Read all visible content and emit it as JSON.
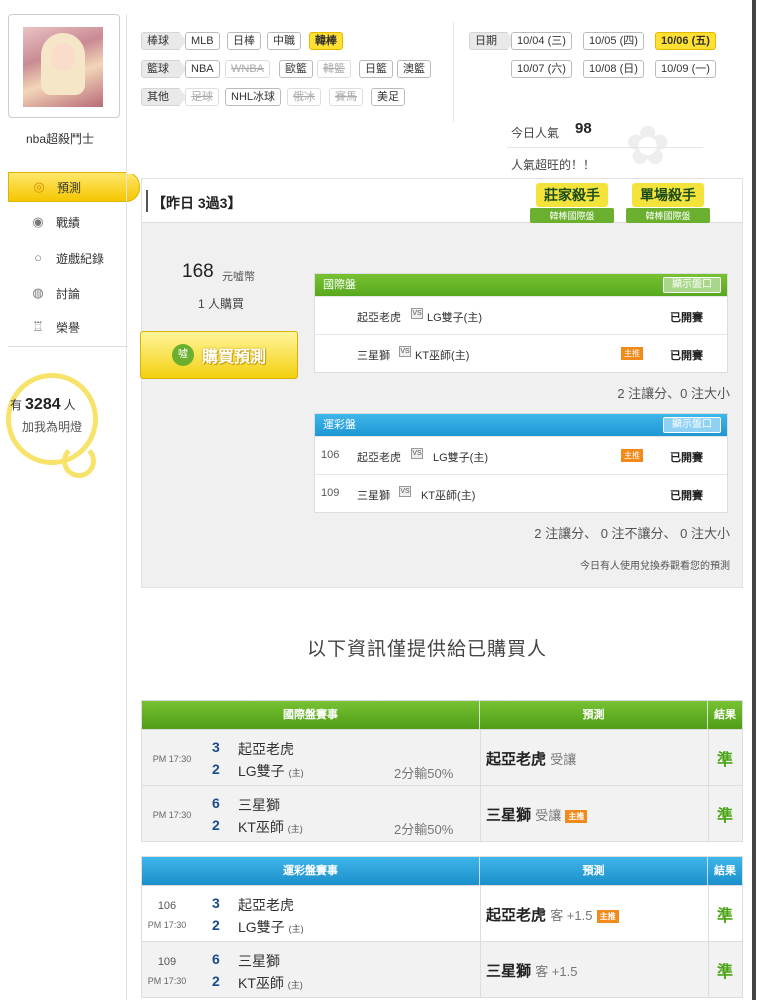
{
  "profile": {
    "username": "nba超殺鬥士"
  },
  "sidebar": {
    "items": [
      {
        "label": "預測",
        "icon": "target-icon",
        "active": true
      },
      {
        "label": "戰績",
        "icon": "record-icon",
        "active": false
      },
      {
        "label": "遊戲紀錄",
        "icon": "circle-icon",
        "active": false
      },
      {
        "label": "討論",
        "icon": "chat-icon",
        "active": false
      },
      {
        "label": "榮譽",
        "icon": "medal-icon",
        "active": false
      }
    ],
    "fans": {
      "prefix": "有",
      "count": "3284",
      "suffix": "人",
      "sub": "加我為明燈"
    }
  },
  "filters": {
    "baseball": {
      "label": "棒球",
      "items": [
        "MLB",
        "日棒",
        "中職",
        "韓棒"
      ]
    },
    "basketball": {
      "label": "籃球",
      "items": [
        "NBA",
        "WNBA",
        "歐籃",
        "韓籃",
        "日籃",
        "澳籃"
      ]
    },
    "other": {
      "label": "其他",
      "items": [
        "足球",
        "NHL冰球",
        "俄冰",
        "賽馬",
        "美足"
      ]
    },
    "date": {
      "label": "日期",
      "items": [
        "10/04 (三)",
        "10/05 (四)",
        "10/06 (五)",
        "10/07 (六)",
        "10/08 (日)",
        "10/09 (一)"
      ]
    }
  },
  "popularity": {
    "label": "今日人氣",
    "value": "98",
    "text": "人氣超旺的！！"
  },
  "panel": {
    "title": "【昨日 3過3】",
    "badges": [
      {
        "main": "莊家殺手",
        "sub": "韓棒國際盤"
      },
      {
        "main": "單場殺手",
        "sub": "韓棒國際盤"
      }
    ],
    "price": "168",
    "price_unit": "元噓幣",
    "buyers": "1 人購買",
    "buy_label": "購買預測",
    "buy_icon": "噓",
    "intl": {
      "title": "國際盤",
      "show": "顯示盤口",
      "rows": [
        {
          "num": "",
          "home": "起亞老虎",
          "away": "LG雙子(主)",
          "hot": "",
          "status": "已開賽"
        },
        {
          "num": "",
          "home": "三星獅",
          "away": "KT巫師(主)",
          "hot": "主推",
          "status": "已開賽"
        }
      ],
      "summary": "2 注讓分、0 注大小"
    },
    "lottery": {
      "title": "運彩盤",
      "show": "顯示盤口",
      "rows": [
        {
          "num": "106",
          "home": "起亞老虎",
          "away": "LG雙子(主)",
          "hot": "主推",
          "status": "已開賽"
        },
        {
          "num": "109",
          "home": "三星獅",
          "away": "KT巫師(主)",
          "hot": "",
          "status": "已開賽"
        }
      ],
      "summary": "2 注讓分、 0 注不讓分、 0 注大小"
    },
    "vs": "VS",
    "note": "今日有人使用兌換券觀看您的預測"
  },
  "info_title": "以下資訊僅提供給已購買人",
  "results_intl": {
    "headers": [
      "國際盤賽事",
      "預測",
      "結果"
    ],
    "rows": [
      {
        "time": "PM 17:30",
        "s1": "3",
        "t1": "起亞老虎",
        "s2": "2",
        "t2": "LG雙子",
        "home": "(主)",
        "pct": "2分輸50%",
        "pred": "起亞老虎",
        "pred_sub": "受讓",
        "hot": "",
        "res": "準"
      },
      {
        "time": "PM 17:30",
        "s1": "6",
        "t1": "三星獅",
        "s2": "2",
        "t2": "KT巫師",
        "home": "(主)",
        "pct": "2分輸50%",
        "pred": "三星獅",
        "pred_sub": "受讓",
        "hot": "主推",
        "res": "準"
      }
    ]
  },
  "results_lottery": {
    "headers": [
      "運彩盤賽事",
      "預測",
      "結果"
    ],
    "rows": [
      {
        "code": "106",
        "time": "PM 17:30",
        "s1": "3",
        "t1": "起亞老虎",
        "s2": "2",
        "t2": "LG雙子",
        "home": "(主)",
        "pred": "起亞老虎",
        "pred_sub": "客 +1.5",
        "hot": "主推",
        "res": "準"
      },
      {
        "code": "109",
        "time": "PM 17:30",
        "s1": "6",
        "t1": "三星獅",
        "s2": "2",
        "t2": "KT巫師",
        "home": "(主)",
        "pred": "三星獅",
        "pred_sub": "客 +1.5",
        "hot": "",
        "res": "準"
      }
    ]
  },
  "colors": {
    "accent_yellow": "#ffe033",
    "green": "#58a81f",
    "blue": "#1e97d4",
    "hot": "#f08a1b",
    "win": "#4aa514"
  }
}
